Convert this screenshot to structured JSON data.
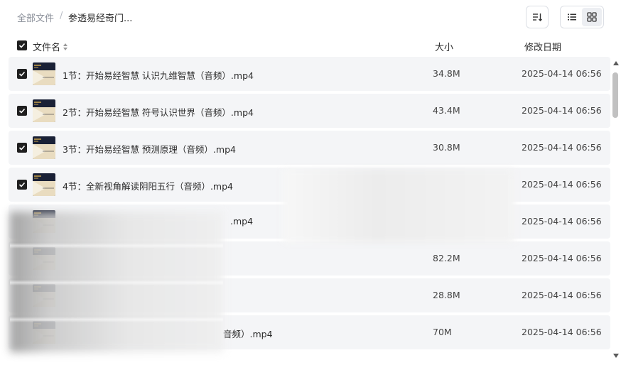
{
  "breadcrumb": {
    "root": "全部文件",
    "separator": "/",
    "current": "参透易经奇门..."
  },
  "toolbar": {
    "sort_icon": "sort-icon",
    "list_view_icon": "list-view-icon",
    "grid_view_icon": "grid-view-icon",
    "active_view": "grid"
  },
  "table": {
    "columns": {
      "name": "文件名",
      "size": "大小",
      "date": "修改日期"
    },
    "rows": [
      {
        "name": "1节：开始易经智慧 认识九维智慧（音频）.mp4",
        "size": "34.8M",
        "date": "2025-04-14 06:56",
        "checked": true
      },
      {
        "name": "2节：开始易经智慧 符号认识世界（音频）.mp4",
        "size": "43.4M",
        "date": "2025-04-14 06:56",
        "checked": true
      },
      {
        "name": "3节：开始易经智慧 预测原理（音频）.mp4",
        "size": "30.8M",
        "date": "2025-04-14 06:56",
        "checked": true
      },
      {
        "name": "4节：全新视角解读阴阳五行（音频）.mp4",
        "size": "",
        "date": "2025-04-14 06:56",
        "checked": true
      },
      {
        "name": ".mp4",
        "size": "",
        "date": "2025-04-14 06:56",
        "checked": false
      },
      {
        "name": "",
        "size": "82.2M",
        "date": "2025-04-14 06:56",
        "checked": false
      },
      {
        "name": "",
        "size": "28.8M",
        "date": "2025-04-14 06:56",
        "checked": false
      },
      {
        "name": "音频）.mp4",
        "size": "70M",
        "date": "2025-04-14 06:56",
        "checked": false
      }
    ]
  },
  "colors": {
    "row_bg": "#f4f5f7",
    "checkbox": "#1f1f1f",
    "thumb_dark": "#1a2136",
    "thumb_light": "#e9dcc0"
  }
}
